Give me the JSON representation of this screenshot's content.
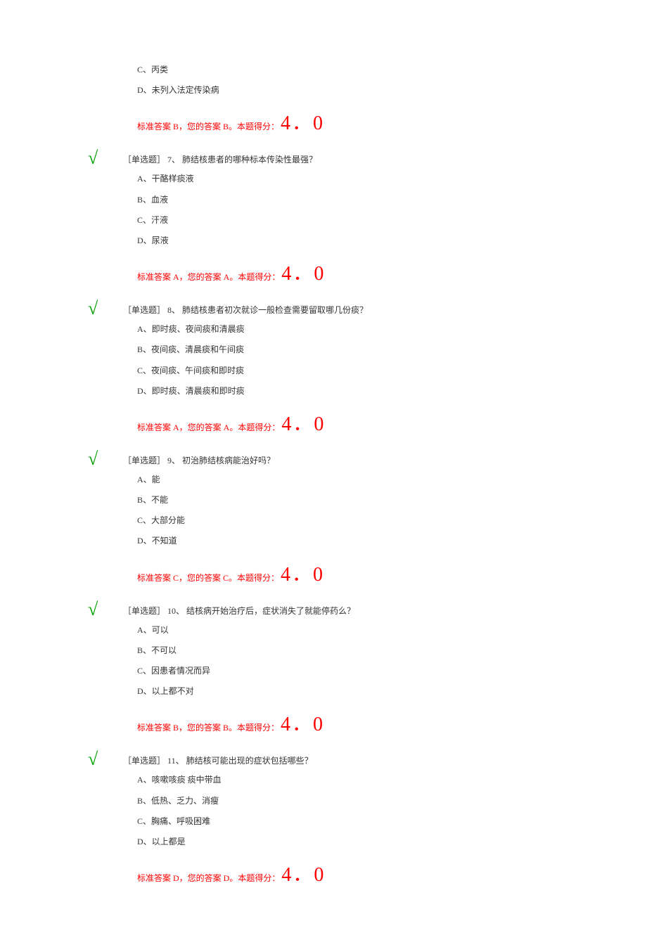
{
  "partial_question": {
    "options": [
      "C、丙类",
      "D、未列入法定传染病"
    ],
    "answer_text": "标准答案 B，您的答案 B。本题得分：",
    "score": "4．0"
  },
  "questions": [
    {
      "type": "［单选题］",
      "number": "7、",
      "text": "肺结核患者的哪种标本传染性最强？",
      "options": [
        "A、干酪样痰液",
        "B、血液",
        "C、汗液",
        "D、尿液"
      ],
      "answer_text": "标准答案 A，您的答案 A。本题得分：",
      "score": "4．0"
    },
    {
      "type": "［单选题］",
      "number": "8、",
      "text": "肺结核患者初次就诊一般检查需要留取哪几份痰？",
      "options": [
        "A、即时痰、夜间痰和清晨痰",
        "B、夜间痰、清晨痰和午间痰",
        "C、夜间痰、午间痰和即时痰",
        "D、即时痰、清晨痰和即时痰"
      ],
      "answer_text": "标准答案 A，您的答案 A。本题得分：",
      "score": "4．0"
    },
    {
      "type": "［单选题］",
      "number": "9、",
      "text": "初治肺结核病能治好吗？",
      "options": [
        "A、能",
        "B、不能",
        "C、大部分能",
        "D、不知道"
      ],
      "answer_text": "标准答案 C，您的答案 C。本题得分：",
      "score": "4．0"
    },
    {
      "type": "［单选题］",
      "number": "10、",
      "text": "结核病开始治疗后，症状消失了就能停药么？",
      "options": [
        "A、可以",
        "B、不可以",
        "C、因患者情况而异",
        "D、以上都不对"
      ],
      "answer_text": "标准答案 B，您的答案 B。本题得分：",
      "score": "4．0"
    },
    {
      "type": "［单选题］",
      "number": "11、",
      "text": "肺结核可能出现的症状包括哪些？",
      "options": [
        "A、咳嗽咳痰 痰中带血",
        "B、低热、乏力、消瘦",
        "C、胸痛、呼吸困难",
        "D、以上都是"
      ],
      "answer_text": "标准答案 D，您的答案 D。本题得分：",
      "score": "4．0"
    }
  ]
}
